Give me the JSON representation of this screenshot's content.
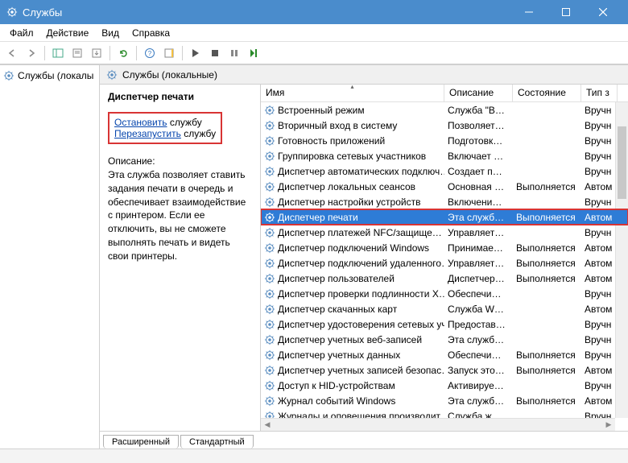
{
  "window": {
    "title": "Службы"
  },
  "menu": {
    "file": "Файл",
    "action": "Действие",
    "view": "Вид",
    "help": "Справка"
  },
  "tree": {
    "root": "Службы (локалы"
  },
  "header": {
    "label": "Службы (локальные)"
  },
  "detail": {
    "name": "Диспетчер печати",
    "stop_link": "Остановить",
    "stop_suffix": " службу",
    "restart_link": "Перезапустить",
    "restart_suffix": " службу",
    "desc_label": "Описание:",
    "desc_text": "Эта служба позволяет ставить задания печати в очередь и обеспечивает взаимодействие с принтером. Если ее отключить, вы не сможете выполнять печать и видеть свои принтеры."
  },
  "columns": {
    "name": "Имя",
    "desc": "Описание",
    "state": "Состояние",
    "type": "Тип з"
  },
  "services": [
    {
      "name": "Встроенный режим",
      "desc": "Служба \"В…",
      "state": "",
      "type": "Вручн",
      "sel": false
    },
    {
      "name": "Вторичный вход в систему",
      "desc": "Позволяет…",
      "state": "",
      "type": "Вручн",
      "sel": false
    },
    {
      "name": "Готовность приложений",
      "desc": "Подготовк…",
      "state": "",
      "type": "Вручн",
      "sel": false
    },
    {
      "name": "Группировка сетевых участников",
      "desc": "Включает …",
      "state": "",
      "type": "Вручн",
      "sel": false
    },
    {
      "name": "Диспетчер автоматических подключ…",
      "desc": "Создает п…",
      "state": "",
      "type": "Вручн",
      "sel": false
    },
    {
      "name": "Диспетчер локальных сеансов",
      "desc": "Основная …",
      "state": "Выполняется",
      "type": "Автом",
      "sel": false
    },
    {
      "name": "Диспетчер настройки устройств",
      "desc": "Включени…",
      "state": "",
      "type": "Вручн",
      "sel": false
    },
    {
      "name": "Диспетчер печати",
      "desc": "Эта служб…",
      "state": "Выполняется",
      "type": "Автом",
      "sel": true,
      "hl": true
    },
    {
      "name": "Диспетчер платежей NFC/защище…",
      "desc": "Управляет…",
      "state": "",
      "type": "Вручн",
      "sel": false
    },
    {
      "name": "Диспетчер подключений Windows",
      "desc": "Принимае…",
      "state": "Выполняется",
      "type": "Автом",
      "sel": false
    },
    {
      "name": "Диспетчер подключений удаленного…",
      "desc": "Управляет…",
      "state": "Выполняется",
      "type": "Автом",
      "sel": false
    },
    {
      "name": "Диспетчер пользователей",
      "desc": "Диспетчер…",
      "state": "Выполняется",
      "type": "Автом",
      "sel": false
    },
    {
      "name": "Диспетчер проверки подлинности X…",
      "desc": "Обеспечи…",
      "state": "",
      "type": "Вручн",
      "sel": false
    },
    {
      "name": "Диспетчер скачанных карт",
      "desc": "Служба W…",
      "state": "",
      "type": "Автом",
      "sel": false
    },
    {
      "name": "Диспетчер удостоверения сетевых уч…",
      "desc": "Предостав…",
      "state": "",
      "type": "Вручн",
      "sel": false
    },
    {
      "name": "Диспетчер учетных веб-записей",
      "desc": "Эта служб…",
      "state": "",
      "type": "Вручн",
      "sel": false
    },
    {
      "name": "Диспетчер учетных данных",
      "desc": "Обеспечи…",
      "state": "Выполняется",
      "type": "Вручн",
      "sel": false
    },
    {
      "name": "Диспетчер учетных записей безопас…",
      "desc": "Запуск это…",
      "state": "Выполняется",
      "type": "Автом",
      "sel": false
    },
    {
      "name": "Доступ к HID-устройствам",
      "desc": "Активируе…",
      "state": "",
      "type": "Вручн",
      "sel": false
    },
    {
      "name": "Журнал событий Windows",
      "desc": "Эта служб…",
      "state": "Выполняется",
      "type": "Автом",
      "sel": false
    },
    {
      "name": "Журналы и оповещения производит…",
      "desc": "Служба ж…",
      "state": "",
      "type": "Вручн",
      "sel": false
    }
  ],
  "tabs": {
    "extended": "Расширенный",
    "standard": "Стандартный"
  }
}
